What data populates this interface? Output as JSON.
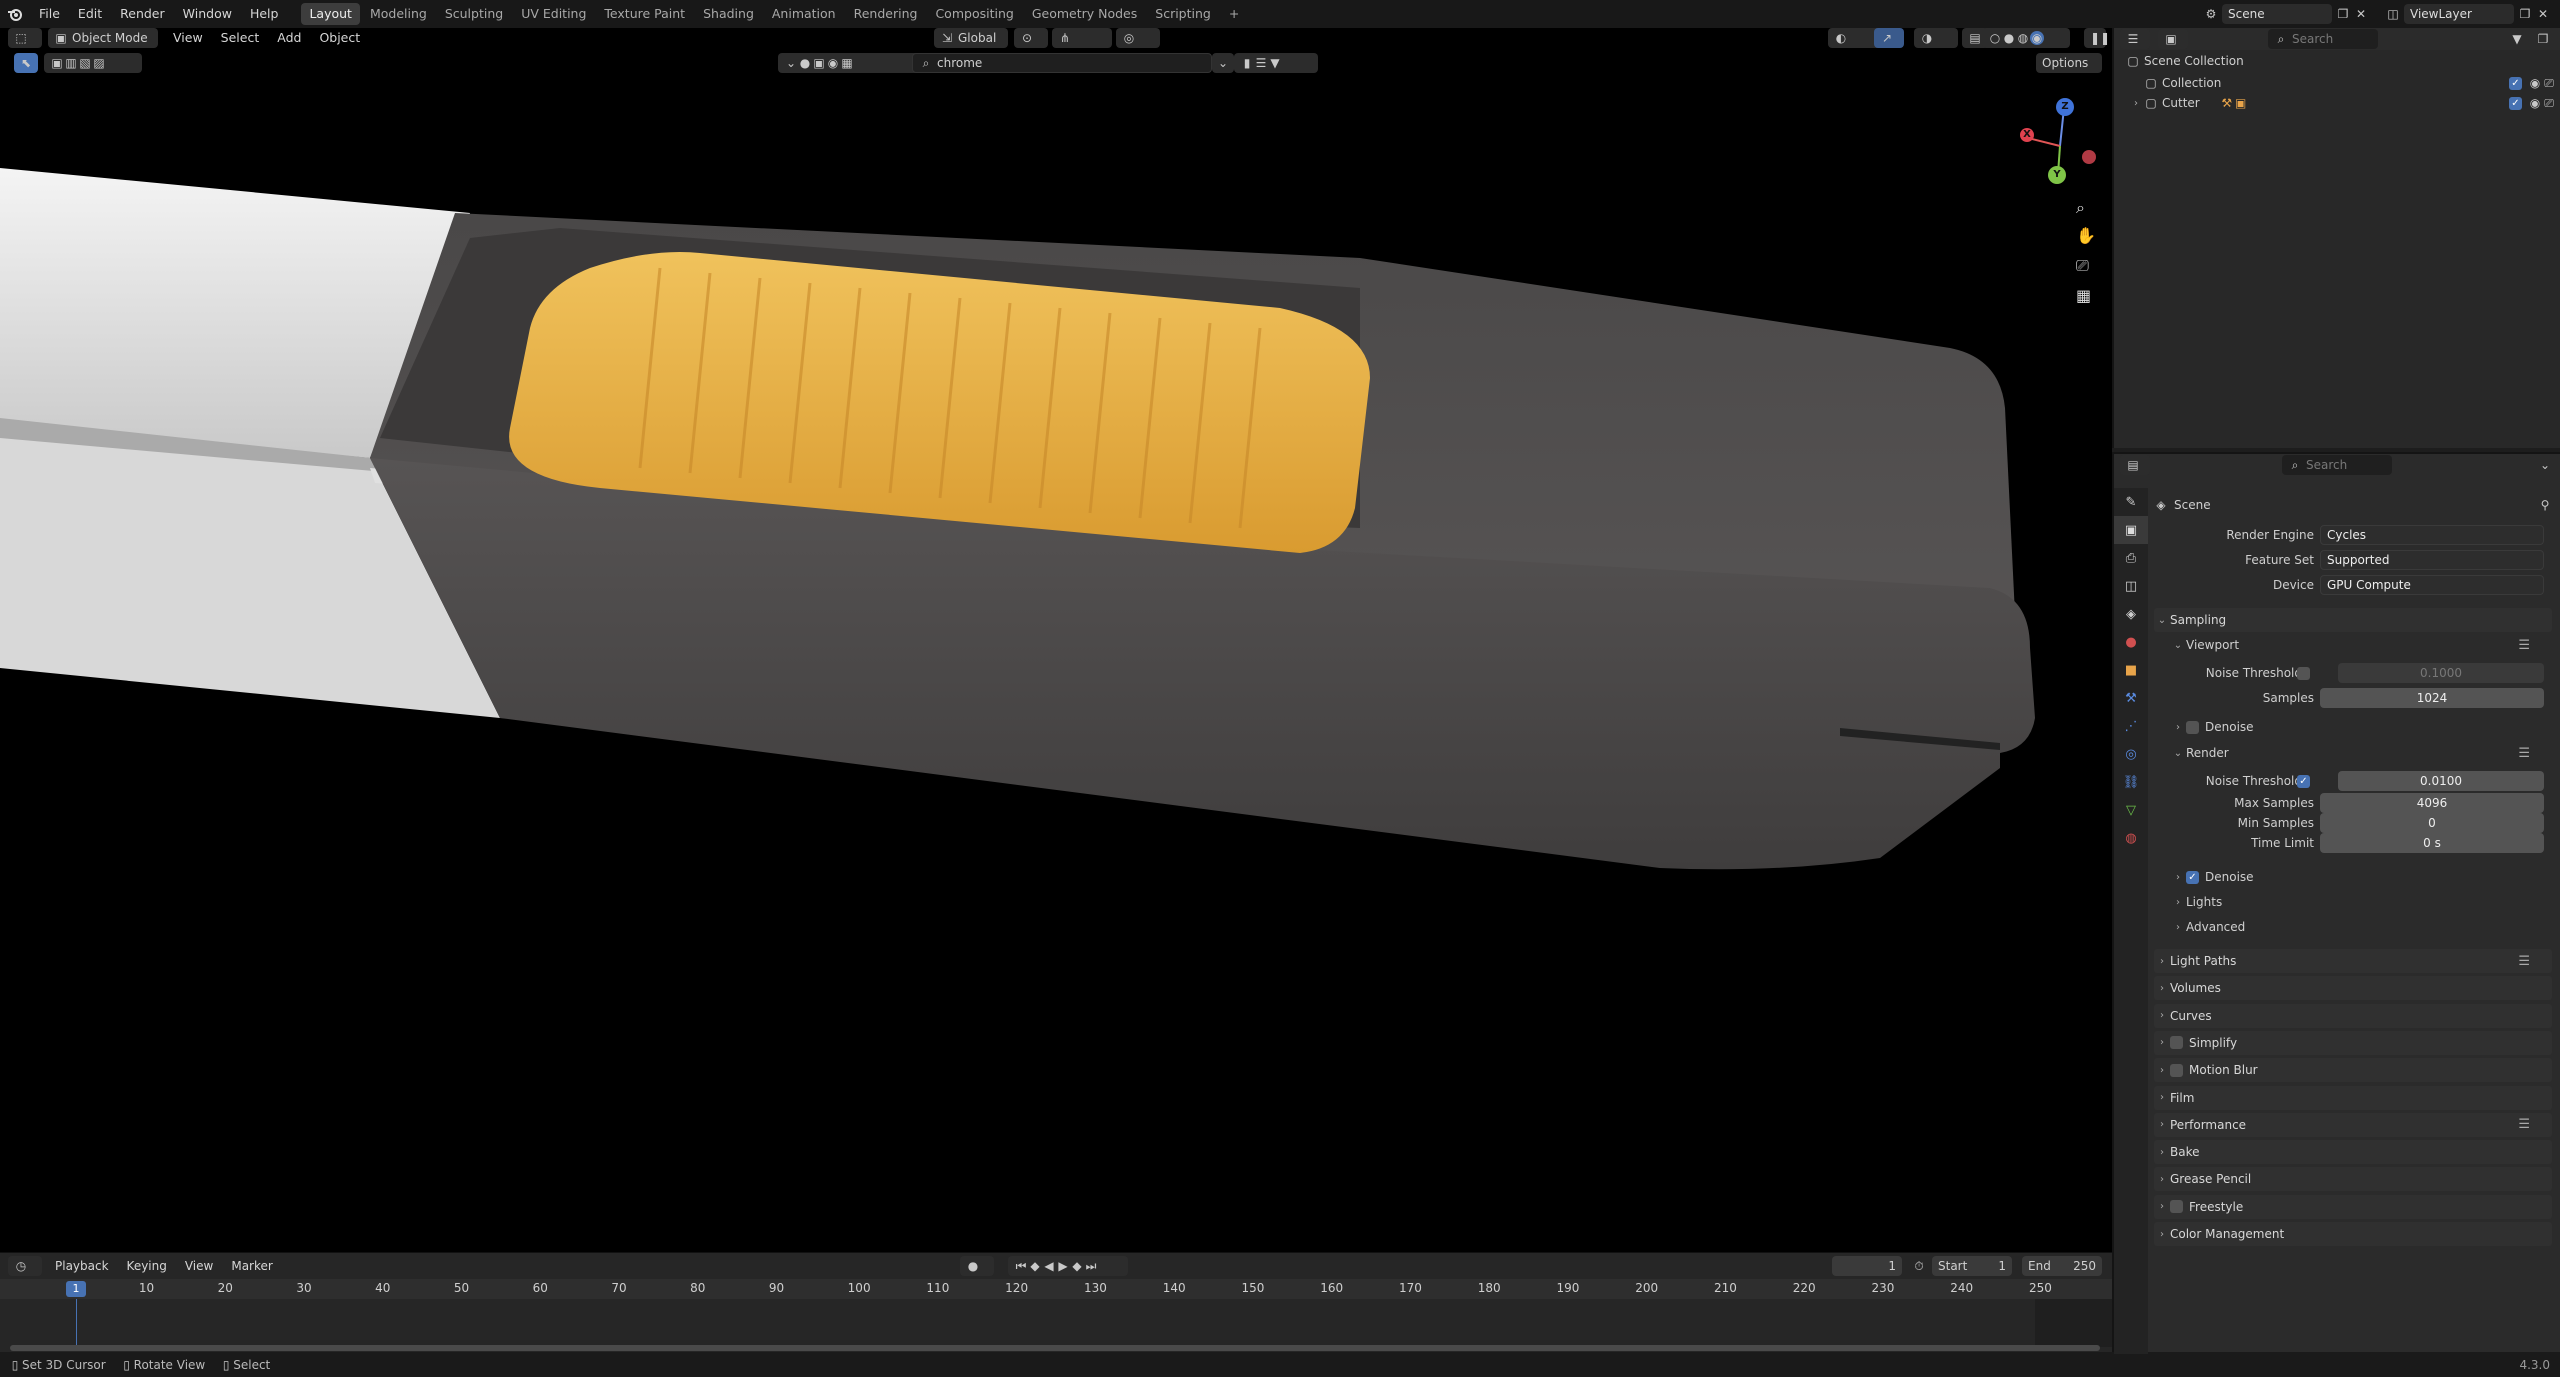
{
  "menu": [
    "File",
    "Edit",
    "Render",
    "Window",
    "Help"
  ],
  "workspaces": [
    "Layout",
    "Modeling",
    "Sculpting",
    "UV Editing",
    "Texture Paint",
    "Shading",
    "Animation",
    "Rendering",
    "Compositing",
    "Geometry Nodes",
    "Scripting"
  ],
  "active_workspace": "Layout",
  "scene_name": "Scene",
  "view_layer": "ViewLayer",
  "viewport_header": {
    "mode": "Object Mode",
    "menus": [
      "View",
      "Select",
      "Add",
      "Object"
    ],
    "orientation": "Global",
    "search_value": "chrome",
    "options_label": "Options"
  },
  "outliner": {
    "search_placeholder": "Search",
    "root": "Scene Collection",
    "items": [
      "Collection",
      "Cutter"
    ]
  },
  "properties": {
    "search_placeholder": "Search",
    "context": "Scene",
    "render_engine_label": "Render Engine",
    "render_engine": "Cycles",
    "feature_set_label": "Feature Set",
    "feature_set": "Supported",
    "device_label": "Device",
    "device": "GPU Compute",
    "sampling": "Sampling",
    "viewport": "Viewport",
    "noise_threshold_label": "Noise Threshold",
    "viewport_noise_threshold": "0.1000",
    "samples_label": "Samples",
    "viewport_samples": "1024",
    "denoise": "Denoise",
    "render": "Render",
    "render_noise_threshold": "0.0100",
    "max_samples_label": "Max Samples",
    "max_samples": "4096",
    "min_samples_label": "Min Samples",
    "min_samples": "0",
    "time_limit_label": "Time Limit",
    "time_limit": "0 s",
    "render_denoise": "Denoise",
    "lights": "Lights",
    "advanced": "Advanced",
    "panels": [
      "Light Paths",
      "Volumes",
      "Curves",
      "Simplify",
      "Motion Blur",
      "Film",
      "Performance",
      "Bake",
      "Grease Pencil",
      "Freestyle",
      "Color Management"
    ]
  },
  "timeline": {
    "menus": [
      "Playback",
      "Keying",
      "View",
      "Marker"
    ],
    "current_frame": "1",
    "start_label": "Start",
    "start": "1",
    "end_label": "End",
    "end": "250",
    "ticks": [
      "10",
      "20",
      "30",
      "40",
      "50",
      "60",
      "70",
      "80",
      "90",
      "100",
      "110",
      "120",
      "130",
      "140",
      "150",
      "160",
      "170",
      "180",
      "190",
      "200",
      "210",
      "220",
      "230",
      "240",
      "250"
    ],
    "playhead": "1"
  },
  "statusbar": {
    "items": [
      "Set 3D Cursor",
      "Rotate View",
      "Select"
    ],
    "version": "4.3.0"
  },
  "gizmo_axes": [
    "X",
    "Y",
    "Z"
  ],
  "colors": {
    "accent": "#4772b3",
    "knob": "#e8b44a",
    "body": "#4f4c4c"
  }
}
